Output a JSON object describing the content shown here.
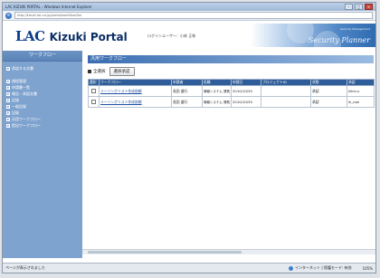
{
  "window": {
    "title": "LAC KIZUKI PORTAL - Windows Internet Explorer",
    "url": "http://kizuki.lac.co.jp/portal/workflow/list"
  },
  "header": {
    "logo_lac": "LAC",
    "logo_portal": "Kizuki Portal",
    "user_info": "ログインユーザー：小林 正和",
    "banner_title": "Security Planner",
    "banner_small": "Security Management"
  },
  "sidebar": {
    "heading": "ワークフロー",
    "items": [
      {
        "label": "承認する文書"
      },
      {
        "label": "規程管理"
      },
      {
        "label": "申請書一覧"
      },
      {
        "label": "報告・承認文書"
      },
      {
        "label": "記録"
      },
      {
        "label": "一般記録"
      },
      {
        "label": "記録"
      },
      {
        "label": "汎用ワークフロー"
      },
      {
        "label": "提出ワークフロー"
      }
    ]
  },
  "main": {
    "title": "汎用ワークフロー",
    "select_all": "全選択",
    "approve_button": "選択承認",
    "columns": [
      "選択",
      "ワークフロー",
      "申請者",
      "役職",
      "申請日",
      "プロジェクトID",
      "状態",
      "承認"
    ],
    "rows": [
      {
        "workflow": "メーリングリスト作成依頼",
        "applicant": "長田 道行",
        "role": "情報システム 課長",
        "date": "2010/10/30",
        "project": "",
        "status": "承認",
        "approval": "kikin-s"
      },
      {
        "workflow": "メーリングリスト作成依頼",
        "applicant": "長田 道行",
        "role": "情報システム 課長",
        "date": "2010/10/30",
        "project": "",
        "status": "承認",
        "approval": "kl_nok"
      }
    ]
  },
  "statusbar": {
    "left": "ページが表示されました",
    "zone": "インターネット | 保護モード: 有効",
    "zoom": "105%"
  }
}
